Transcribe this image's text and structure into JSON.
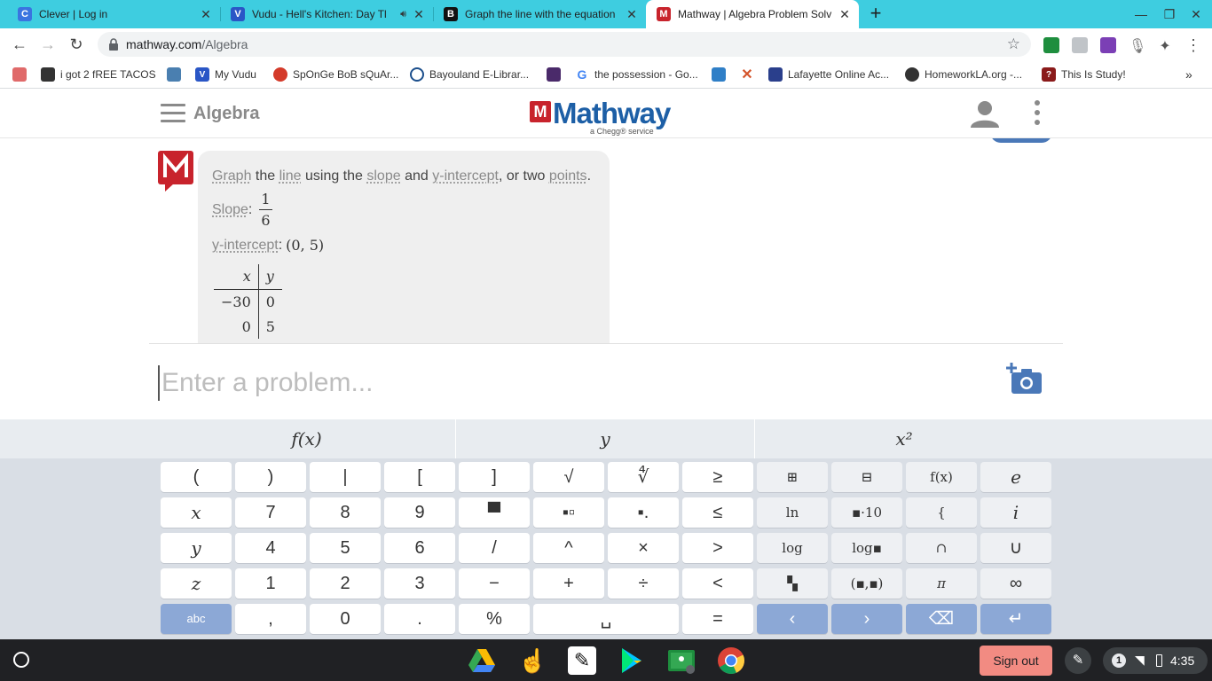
{
  "tabs": [
    {
      "title": "Clever | Log in",
      "favicon": "clever-icon",
      "color": "#3a74e0",
      "glyph": "C"
    },
    {
      "title": "Vudu - Hell's Kitchen: Day Tl",
      "favicon": "vudu-icon",
      "color": "#2a56c6",
      "glyph": "V",
      "audio": "speaker-icon"
    },
    {
      "title": "Graph the line with the equation",
      "favicon": "bartleby-icon",
      "color": "#111111",
      "glyph": "B"
    },
    {
      "title": "Mathway | Algebra Problem Solv",
      "favicon": "mathway-icon",
      "color": "#c8232c",
      "glyph": "M",
      "active": true
    }
  ],
  "address": {
    "host": "mathway.com",
    "path": "/Algebra"
  },
  "bookmarks": [
    {
      "label": "",
      "icon": "pig-icon",
      "color": "#e06a6a"
    },
    {
      "label": "i got 2 fREE TACOS",
      "icon": "image-icon",
      "color": "#333333"
    },
    {
      "label": "",
      "icon": "utensils-icon",
      "color": "#4a7fb0"
    },
    {
      "label": "My Vudu",
      "icon": "vudu-icon",
      "color": "#2a56c6"
    },
    {
      "label": "SpOnGe BoB sQuAr...",
      "icon": "food-icon",
      "color": "#d43a2a"
    },
    {
      "label": "Bayouland E-Librar...",
      "icon": "overdrive-icon",
      "color": "#1c4f8c"
    },
    {
      "label": "",
      "icon": "quizlet-icon",
      "color": "#4a2a6a"
    },
    {
      "label": "the possession - Go...",
      "icon": "google-icon",
      "color": "#4285f4"
    },
    {
      "label": "",
      "icon": "pinwheel-icon",
      "color": "#2f7fc7"
    },
    {
      "label": "",
      "icon": "x-tool-icon",
      "color": "#d4542a"
    },
    {
      "label": "Lafayette Online Ac...",
      "icon": "academy-icon",
      "color": "#2a3f8c"
    },
    {
      "label": "HomeworkLA.org -...",
      "icon": "globe-icon",
      "color": "#333333"
    },
    {
      "label": "This Is Study!",
      "icon": "question-icon",
      "color": "#8a1a1a"
    }
  ],
  "header": {
    "subject": "Algebra",
    "logo_text": "Mathway",
    "logo_sub": "a Chegg® service"
  },
  "answer": {
    "words": {
      "graph": "Graph",
      "the": "the",
      "line": "line",
      "using_the": "using the",
      "slope": "slope",
      "and": "and",
      "y_intercept": "y-intercept",
      "or_two": ", or two",
      "points": "points",
      "period": "."
    },
    "slope_label": "Slope",
    "slope_num": "1",
    "slope_den": "6",
    "yint_label": "y-intercept",
    "yint_value": "(0, 5)",
    "table": {
      "headers": [
        "x",
        "y"
      ],
      "rows": [
        [
          "−30",
          "0"
        ],
        [
          "0",
          "5"
        ]
      ]
    }
  },
  "input": {
    "placeholder": "Enter a problem..."
  },
  "keypad_tabs": [
    "f(x)",
    "y",
    "x²"
  ],
  "keypad_rows": [
    [
      "(",
      ")",
      "|",
      "[",
      "]",
      "√",
      "∜",
      "≥",
      "⊞",
      "⊟",
      "f(x)",
      "e"
    ],
    [
      "x",
      "7",
      "8",
      "9",
      "▀",
      "▪▫",
      "▪.",
      "≤",
      "ln",
      "▪·10",
      "{",
      "i"
    ],
    [
      "y",
      "4",
      "5",
      "6",
      "/",
      "^",
      "×",
      ">",
      "log",
      "log▪",
      "∩",
      "∪"
    ],
    [
      "z",
      "1",
      "2",
      "3",
      "−",
      "+",
      "÷",
      "<",
      "▚",
      "(▪,▪)",
      "π",
      "∞"
    ],
    [
      "abc",
      ",",
      "0",
      ".",
      "%",
      "␣",
      "=",
      "‹",
      "›",
      "⌫",
      "↵"
    ]
  ],
  "shelf": {
    "sign_out": "Sign out",
    "notifications": "1",
    "time": "4:35"
  }
}
